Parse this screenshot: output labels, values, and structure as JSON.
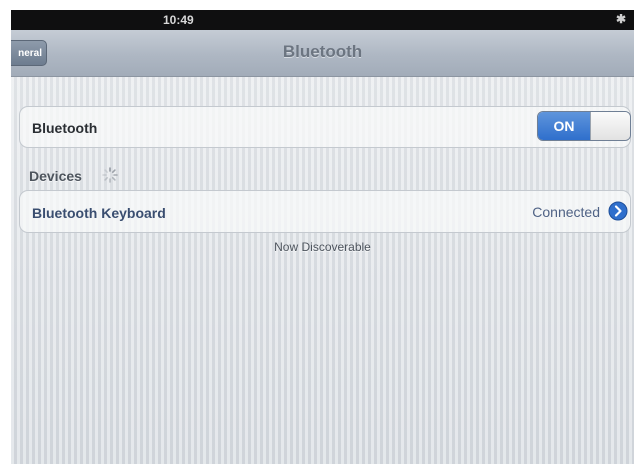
{
  "status_bar": {
    "time": "10:49",
    "bluetooth_glyph": "✱"
  },
  "nav": {
    "back_label": "neral",
    "title": "Bluetooth"
  },
  "bluetooth_row": {
    "label": "Bluetooth",
    "toggle_label": "ON"
  },
  "devices": {
    "header": "Devices",
    "items": [
      {
        "name": "Bluetooth Keyboard",
        "status": "Connected"
      }
    ]
  },
  "footer": {
    "note": "Now Discoverable"
  },
  "colors": {
    "toggle_on": "#2f6fcc",
    "device_label": "#3a4e70",
    "disclosure": "#2f6fcc"
  },
  "icons": {
    "spinner": "spinner-icon",
    "disclosure": "chevron-right-circle-icon",
    "bluetooth": "bluetooth-icon"
  }
}
